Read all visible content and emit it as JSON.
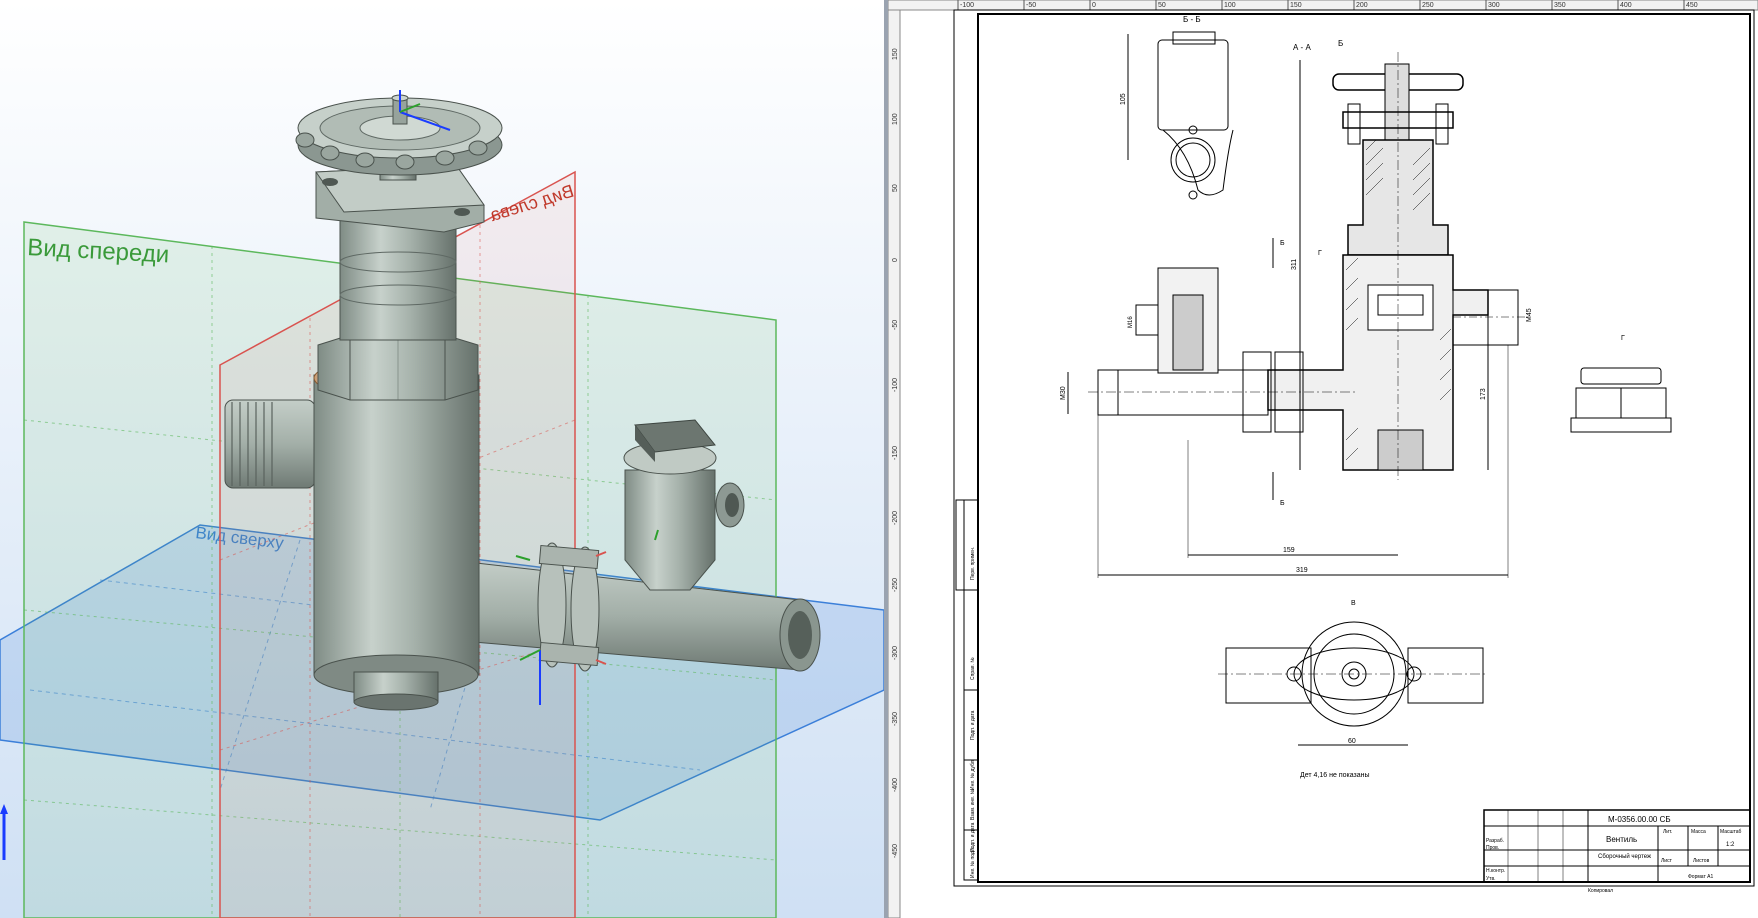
{
  "viewport_3d": {
    "plane_front_label": "Вид спереди",
    "plane_left_label": "Вид слева",
    "plane_top_label": "Вид сверху"
  },
  "colors": {
    "front_plane": "#5cb85c",
    "left_plane": "#d9534f",
    "top_plane": "#3b7fd9",
    "part_fill": "#a9b5ae",
    "axis_y": "#1a3cff",
    "axis_z": "#2ca02c"
  },
  "drawing": {
    "ruler_top": [
      "-100",
      "-50",
      "0",
      "50",
      "100",
      "150",
      "200",
      "250",
      "300",
      "350",
      "400",
      "450"
    ],
    "ruler_left": [
      "150",
      "100",
      "50",
      "0",
      "-50",
      "-100",
      "-150",
      "-200",
      "-250",
      "-300",
      "-350",
      "-400",
      "-450"
    ],
    "section_bb": "Б - Б",
    "section_aa": "А - А",
    "view_g": "Г",
    "view_v": "В",
    "mark_b": "Б",
    "dim_105": "105",
    "dim_311": "311",
    "dim_173": "173",
    "dim_159": "159",
    "dim_319": "319",
    "dim_60": "60",
    "dim_m45": "М45",
    "dim_m30": "М30",
    "dim_m16": "М16",
    "note": "Дет 4,16 не показаны",
    "title_block": {
      "doc_number": "М-0356.00.00 СБ",
      "name": "Вентиль",
      "doc_type": "Сборочный чертеж",
      "lit_label": "Лит.",
      "mass_label": "Масса",
      "scale_label": "Масштаб",
      "scale_value": "1:2",
      "sheet_label": "Лист",
      "sheets_label": "Листов",
      "developer": "Разраб.",
      "checker": "Пров.",
      "norm": "Н.контр.",
      "approved": "Утв.",
      "format_label": "Формат А1",
      "copied": "Копировал"
    },
    "side_stamps": [
      "Перв. примен.",
      "Справ. №",
      "Подп. и дата",
      "Инв. № дубл.",
      "Взам. инв. №",
      "Подп. и дата",
      "Инв. № подл."
    ]
  }
}
